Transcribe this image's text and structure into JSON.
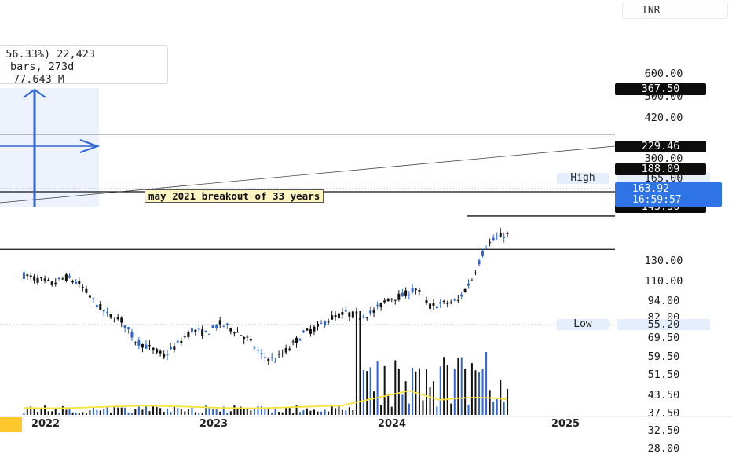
{
  "chart_data": {
    "type": "candlestick",
    "currency": "INR",
    "price_axis_ticks": [
      "600.00",
      "500.00",
      "420.00",
      "300.00",
      "260.00",
      "220.00",
      "165.00",
      "130.00",
      "110.00",
      "94.00",
      "82.00",
      "69.50",
      "59.50",
      "51.50",
      "43.50",
      "37.50",
      "32.50",
      "28.00"
    ],
    "x_ticks": [
      "2022",
      "2023",
      "2024",
      "2025"
    ],
    "horizontal_levels": [
      {
        "label": "367.50",
        "value": 367.5
      },
      {
        "label": "229.46",
        "value": 229.46
      },
      {
        "label": "188.09",
        "value": 188.09
      },
      {
        "label": "143.30",
        "value": 143.3
      }
    ],
    "current_price": {
      "price": "163.92",
      "countdown": "16:59:57"
    },
    "high": {
      "label": "High",
      "value": "165.00"
    },
    "low": {
      "label": "Low",
      "value": "55.20"
    },
    "annotation": "may 2021 breakout of 33 years",
    "measure_tool": {
      "line1": "l 56.33%) 22,423",
      "line2": "bars, 273d",
      "line3": "77.643 M"
    },
    "price_path": [
      [
        "2021-11",
        116
      ],
      [
        "2021-12",
        112
      ],
      [
        "2022-01",
        108
      ],
      [
        "2022-02",
        114
      ],
      [
        "2022-03",
        108
      ],
      [
        "2022-04",
        94
      ],
      [
        "2022-05",
        84
      ],
      [
        "2022-06",
        80
      ],
      [
        "2022-07",
        68
      ],
      [
        "2022-08",
        64
      ],
      [
        "2022-09",
        60
      ],
      [
        "2022-10",
        66
      ],
      [
        "2022-11",
        74
      ],
      [
        "2022-12",
        72
      ],
      [
        "2023-01",
        78
      ],
      [
        "2023-02",
        74
      ],
      [
        "2023-03",
        69
      ],
      [
        "2023-04",
        60
      ],
      [
        "2023-05",
        58
      ],
      [
        "2023-06",
        64
      ],
      [
        "2023-07",
        72
      ],
      [
        "2023-08",
        76
      ],
      [
        "2023-09",
        82
      ],
      [
        "2023-10",
        85
      ],
      [
        "2023-11",
        83
      ],
      [
        "2023-12",
        86
      ],
      [
        "2024-01",
        96
      ],
      [
        "2024-02",
        98
      ],
      [
        "2024-03",
        104
      ],
      [
        "2024-04",
        90
      ],
      [
        "2024-05",
        92
      ],
      [
        "2024-06",
        94
      ],
      [
        "2024-07",
        112
      ],
      [
        "2024-08",
        148
      ],
      [
        "2024-09",
        160
      ],
      [
        "2024-10",
        164
      ]
    ],
    "volume_ma_color": "#f5e23a",
    "up_color": "#2e64d6",
    "down_color": "#111111"
  }
}
